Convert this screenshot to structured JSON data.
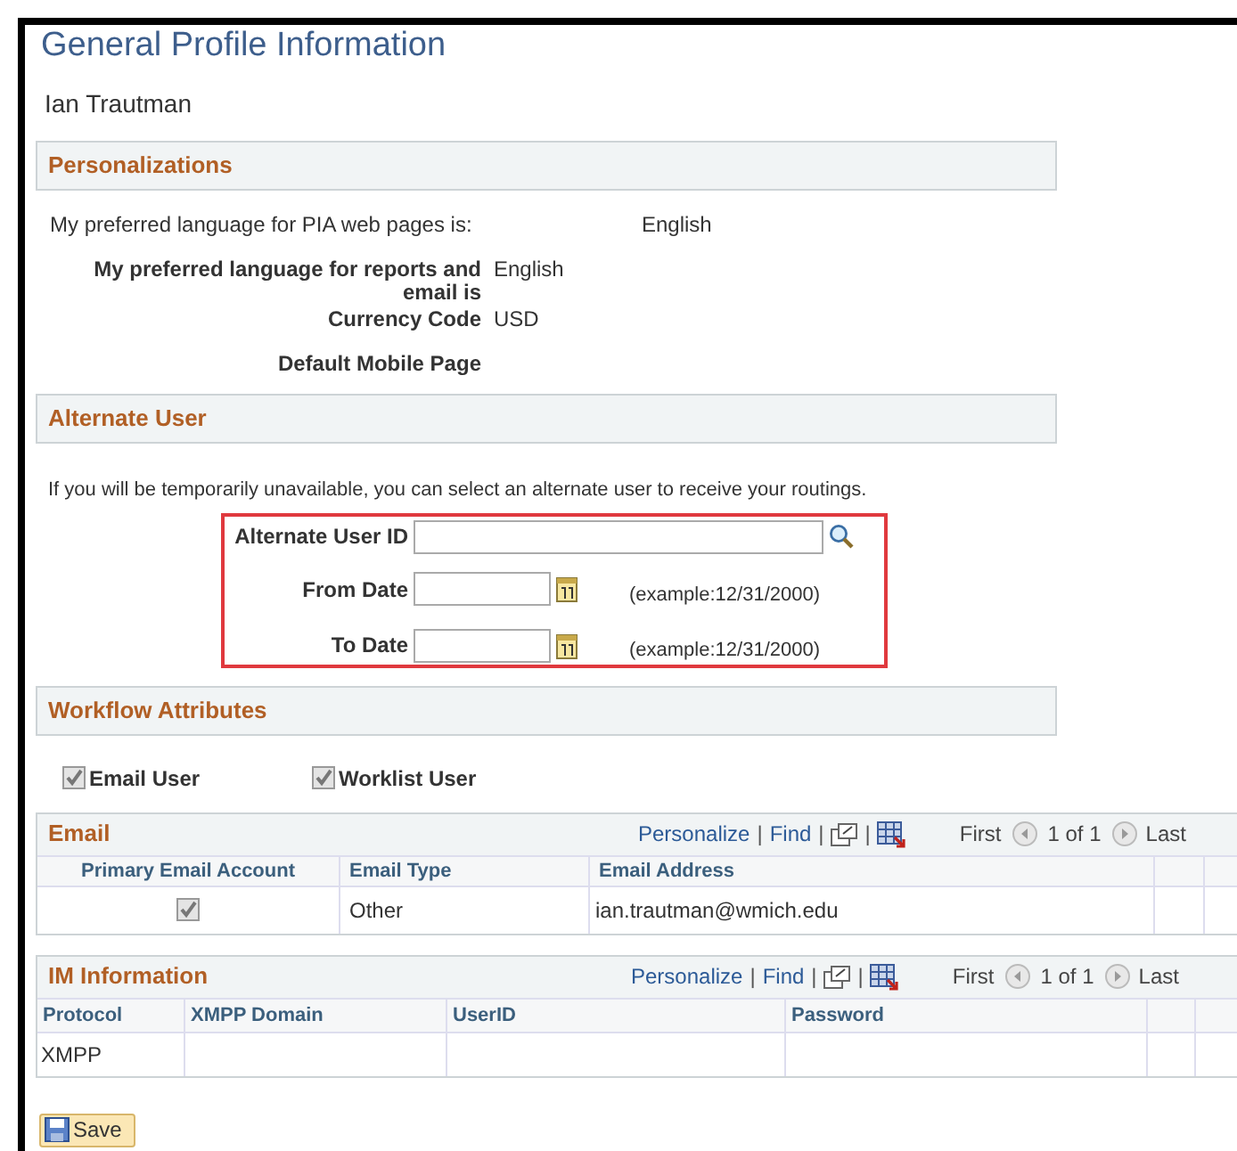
{
  "page_title": "General Profile Information",
  "user_name": "Ian Trautman",
  "personalizations": {
    "heading": "Personalizations",
    "pia_language": {
      "label": "My preferred language for PIA web pages is:",
      "value": "English"
    },
    "fields": [
      {
        "label": "My preferred language for reports and email is",
        "value": "English"
      },
      {
        "label": "Currency Code",
        "value": "USD"
      },
      {
        "label": "Default Mobile Page"
      }
    ]
  },
  "alternate_user": {
    "heading": "Alternate User",
    "instructions": "If you will be temporarily unavailable, you can select an alternate user to receive your routings.",
    "fields": [
      {
        "kind": "lookup",
        "label": "Alternate User ID"
      },
      {
        "kind": "date",
        "label": "From Date",
        "hint": "(example:12/31/2000)"
      },
      {
        "kind": "date",
        "label": "To Date",
        "hint": "(example:12/31/2000)"
      }
    ]
  },
  "workflow_attributes": {
    "heading": "Workflow Attributes",
    "options": [
      {
        "label": "Email User",
        "checked": true
      },
      {
        "label": "Worklist User",
        "checked": true
      }
    ]
  },
  "email_grid": {
    "heading": "Email",
    "toolbar": [
      {
        "kind": "link",
        "text": "Personalize"
      },
      {
        "kind": "separator",
        "text": "|"
      },
      {
        "kind": "link",
        "text": "Find"
      },
      {
        "kind": "separator",
        "text": "|"
      },
      {
        "kind": "zoom_icon"
      },
      {
        "kind": "separator",
        "text": "|"
      },
      {
        "kind": "download_icon"
      }
    ],
    "first": "First",
    "count": "1 of 1",
    "last": "Last",
    "columns": [
      "Primary Email Account",
      "Email Type",
      "Email Address"
    ],
    "rows": [
      {
        "primary": true,
        "type": "Other",
        "address": "ian.trautman@wmich.edu"
      }
    ]
  },
  "im_grid": {
    "heading": "IM Information",
    "toolbar": [
      {
        "kind": "link",
        "text": "Personalize"
      },
      {
        "kind": "separator",
        "text": "|"
      },
      {
        "kind": "link",
        "text": "Find"
      },
      {
        "kind": "separator",
        "text": "|"
      },
      {
        "kind": "zoom_icon"
      },
      {
        "kind": "separator",
        "text": "|"
      },
      {
        "kind": "download_icon"
      }
    ],
    "first": "First",
    "count": "1 of 1",
    "last": "Last",
    "columns": [
      "Protocol",
      "XMPP Domain",
      "UserID",
      "Password"
    ],
    "rows": [
      [
        "XMPP",
        "",
        "",
        ""
      ]
    ]
  },
  "save_button": "Save"
}
